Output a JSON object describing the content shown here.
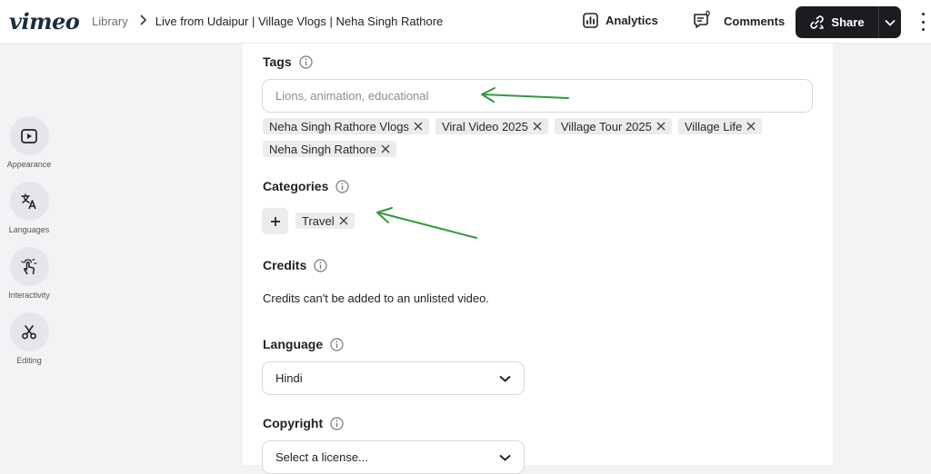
{
  "header": {
    "logo": "vimeo",
    "breadcrumb": {
      "library": "Library",
      "title": "Live from Udaipur | Village Vlogs | Neha Singh Rathore"
    },
    "analytics_label": "Analytics",
    "comments_label": "Comments",
    "comments_count": "0",
    "share_label": "Share"
  },
  "sidebar": {
    "items": [
      {
        "label": "Appearance",
        "icon": "play-square-icon"
      },
      {
        "label": "Languages",
        "icon": "translate-icon"
      },
      {
        "label": "Interactivity",
        "icon": "tap-hand-icon"
      },
      {
        "label": "Editing",
        "icon": "scissors-icon"
      }
    ]
  },
  "tags": {
    "title": "Tags",
    "placeholder": "Lions, animation, educational",
    "items": [
      "Neha Singh Rathore Vlogs",
      "Viral Video 2025",
      "Village Tour 2025",
      "Village Life",
      "Neha Singh Rathore"
    ]
  },
  "categories": {
    "title": "Categories",
    "items": [
      "Travel"
    ]
  },
  "credits": {
    "title": "Credits",
    "note": "Credits can't be added to an unlisted video."
  },
  "language": {
    "title": "Language",
    "selected": "Hindi"
  },
  "copyright": {
    "title": "Copyright",
    "selected": "Select a license..."
  },
  "colors": {
    "annotation_arrow": "#2e9a3e",
    "share_bg": "#1b1c1f"
  }
}
